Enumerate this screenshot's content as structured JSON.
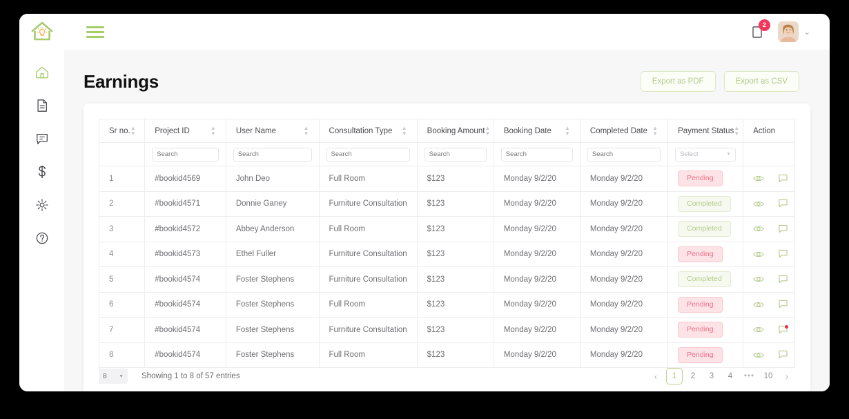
{
  "brand": {
    "logo_icon": "house-lightbulb-logo",
    "accent": "#a6cc6e",
    "danger": "#ef6f8a"
  },
  "topbar": {
    "menu_icon": "hamburger-menu-icon",
    "notification_icon": "notification-icon",
    "notification_count": "2",
    "avatar_label": "avatar",
    "chevron": "⌄"
  },
  "sidebar": {
    "items": [
      {
        "icon": "home-icon",
        "name": "sidebar-item-home",
        "active": true
      },
      {
        "icon": "document-icon",
        "name": "sidebar-item-documents",
        "active": false
      },
      {
        "icon": "chat-icon",
        "name": "sidebar-item-messages",
        "active": false
      },
      {
        "icon": "dollar-icon",
        "name": "sidebar-item-earnings",
        "active": false
      },
      {
        "icon": "gear-icon",
        "name": "sidebar-item-settings",
        "active": false
      },
      {
        "icon": "help-icon",
        "name": "sidebar-item-help",
        "active": false
      }
    ]
  },
  "page": {
    "title": "Earnings",
    "export_pdf_label": "Export as PDF",
    "export_csv_label": "Export as CSV"
  },
  "table": {
    "columns": [
      {
        "label": "Sr no.",
        "sortable": true
      },
      {
        "label": "Project ID",
        "sortable": true
      },
      {
        "label": "User Name",
        "sortable": true
      },
      {
        "label": "Consultation Type",
        "sortable": true
      },
      {
        "label": "Booking Amount",
        "sortable": true
      },
      {
        "label": "Booking Date",
        "sortable": true
      },
      {
        "label": "Completed Date",
        "sortable": true
      },
      {
        "label": "Payment Status",
        "sortable": true
      },
      {
        "label": "Action",
        "sortable": false
      }
    ],
    "filters": {
      "sr_no": null,
      "project_id_placeholder": "Search",
      "user_name_placeholder": "Search",
      "consultation_type_placeholder": "Search",
      "booking_amount_placeholder": "Search",
      "booking_date_placeholder": "Search",
      "completed_date_placeholder": "Search",
      "payment_status_placeholder": "Select"
    },
    "rows": [
      {
        "sr": "1",
        "project_id": "#bookid4569",
        "user_name": "John Deo",
        "consultation_type": "Full Room",
        "booking_amount": "$123",
        "booking_date": "Monday 9/2/20",
        "completed_date": "Monday 9/2/20",
        "status": "Pending",
        "status_kind": "pending",
        "chat_alert": false
      },
      {
        "sr": "2",
        "project_id": "#bookid4571",
        "user_name": "Donnie Ganey",
        "consultation_type": "Furniture Consultation",
        "booking_amount": "$123",
        "booking_date": "Monday 9/2/20",
        "completed_date": "Monday 9/2/20",
        "status": "Completed",
        "status_kind": "completed",
        "chat_alert": false
      },
      {
        "sr": "3",
        "project_id": "#bookid4572",
        "user_name": "Abbey Anderson",
        "consultation_type": "Full Room",
        "booking_amount": "$123",
        "booking_date": "Monday 9/2/20",
        "completed_date": "Monday 9/2/20",
        "status": "Completed",
        "status_kind": "completed",
        "chat_alert": false
      },
      {
        "sr": "4",
        "project_id": "#bookid4573",
        "user_name": "Ethel Fuller",
        "consultation_type": "Furniture Consultation",
        "booking_amount": "$123",
        "booking_date": "Monday 9/2/20",
        "completed_date": "Monday 9/2/20",
        "status": "Pending",
        "status_kind": "pending",
        "chat_alert": false
      },
      {
        "sr": "5",
        "project_id": "#bookid4574",
        "user_name": "Foster Stephens",
        "consultation_type": "Furniture Consultation",
        "booking_amount": "$123",
        "booking_date": "Monday 9/2/20",
        "completed_date": "Monday 9/2/20",
        "status": "Completed",
        "status_kind": "completed",
        "chat_alert": false
      },
      {
        "sr": "6",
        "project_id": "#bookid4574",
        "user_name": "Foster Stephens",
        "consultation_type": "Full Room",
        "booking_amount": "$123",
        "booking_date": "Monday 9/2/20",
        "completed_date": "Monday 9/2/20",
        "status": "Pending",
        "status_kind": "pending",
        "chat_alert": false
      },
      {
        "sr": "7",
        "project_id": "#bookid4574",
        "user_name": "Foster Stephens",
        "consultation_type": "Furniture Consultation",
        "booking_amount": "$123",
        "booking_date": "Monday 9/2/20",
        "completed_date": "Monday 9/2/20",
        "status": "Pending",
        "status_kind": "pending",
        "chat_alert": true
      },
      {
        "sr": "8",
        "project_id": "#bookid4574",
        "user_name": "Foster Stephens",
        "consultation_type": "Full Room",
        "booking_amount": "$123",
        "booking_date": "Monday 9/2/20",
        "completed_date": "Monday 9/2/20",
        "status": "Pending",
        "status_kind": "pending",
        "chat_alert": false
      }
    ],
    "action_icons": {
      "view": "eye-icon",
      "chat": "chat-bubble-icon"
    }
  },
  "footer": {
    "page_size": "8",
    "showing_text": "Showing 1 to 8 of 57 entries",
    "pagination": {
      "prev": "‹",
      "next": "›",
      "pages": [
        "1",
        "2",
        "3",
        "4",
        "•••",
        "10"
      ],
      "active_page": "1"
    }
  }
}
